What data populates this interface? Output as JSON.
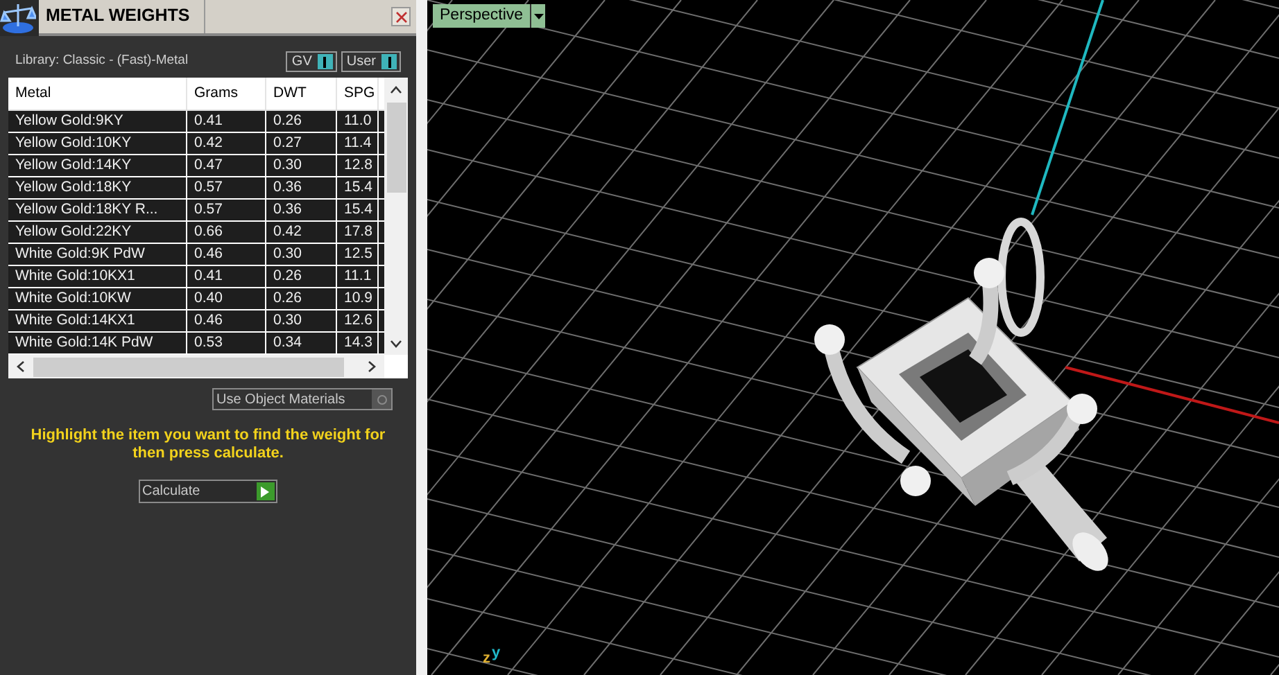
{
  "panel": {
    "title": "METAL WEIGHTS",
    "library": "Library: Classic - (Fast)-Metal",
    "toggles": [
      {
        "label": "GV",
        "on": true
      },
      {
        "label": "User",
        "on": true
      }
    ],
    "table": {
      "columns": [
        "Metal",
        "Grams",
        "DWT",
        "SPG"
      ],
      "rows": [
        [
          "Yellow Gold:9KY",
          "0.41",
          "0.26",
          "11.0"
        ],
        [
          "Yellow Gold:10KY",
          "0.42",
          "0.27",
          "11.4"
        ],
        [
          "Yellow Gold:14KY",
          "0.47",
          "0.30",
          "12.8"
        ],
        [
          "Yellow Gold:18KY",
          "0.57",
          "0.36",
          "15.4"
        ],
        [
          "Yellow Gold:18KY R...",
          "0.57",
          "0.36",
          "15.4"
        ],
        [
          "Yellow Gold:22KY",
          "0.66",
          "0.42",
          "17.8"
        ],
        [
          "White Gold:9K PdW",
          "0.46",
          "0.30",
          "12.5"
        ],
        [
          "White Gold:10KX1",
          "0.41",
          "0.26",
          "11.1"
        ],
        [
          "White Gold:10KW",
          "0.40",
          "0.26",
          "10.9"
        ],
        [
          "White Gold:14KX1",
          "0.46",
          "0.30",
          "12.6"
        ],
        [
          "White Gold:14K PdW",
          "0.53",
          "0.34",
          "14.3"
        ]
      ]
    },
    "use_object_materials": {
      "label": "Use Object Materials",
      "checked": false
    },
    "hint": "Highlight the item you want to find the weight for then press calculate.",
    "calculate_button": "Calculate"
  },
  "viewport": {
    "view_menu": "Perspective",
    "axis_labels": [
      "z",
      "y"
    ]
  }
}
